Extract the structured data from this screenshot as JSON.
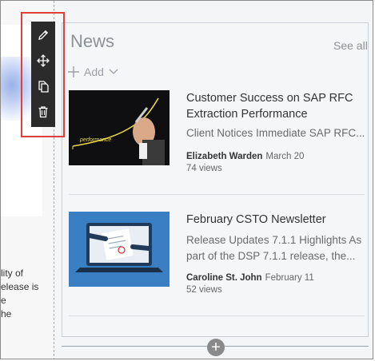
{
  "left_partial_text": [
    "lity of",
    "elease is",
    "e",
    "he"
  ],
  "toolbar": {
    "buttons": [
      {
        "icon": "pencil-icon",
        "name": "edit-button"
      },
      {
        "icon": "move-icon",
        "name": "move-button"
      },
      {
        "icon": "copy-icon",
        "name": "duplicate-button"
      },
      {
        "icon": "trash-icon",
        "name": "delete-button"
      }
    ],
    "highlight_color": "#e0403c"
  },
  "news": {
    "title": "News",
    "see_all": "See all",
    "add_label": "Add",
    "items": [
      {
        "title": "Customer Success on SAP RFC Extraction Performance",
        "description": "Client Notices Immediate SAP RFC...",
        "author": "Elizabeth Warden",
        "date": "March 20",
        "views": "74 views",
        "thumb_text": "performance"
      },
      {
        "title": "February CSTO Newsletter",
        "description": "Release Updates 7.1.1 Highlights As part of the DSP 7.1.1 release, the...",
        "author": "Caroline St. John",
        "date": "February 11",
        "views": "52 views"
      }
    ]
  },
  "add_section_label": "+"
}
